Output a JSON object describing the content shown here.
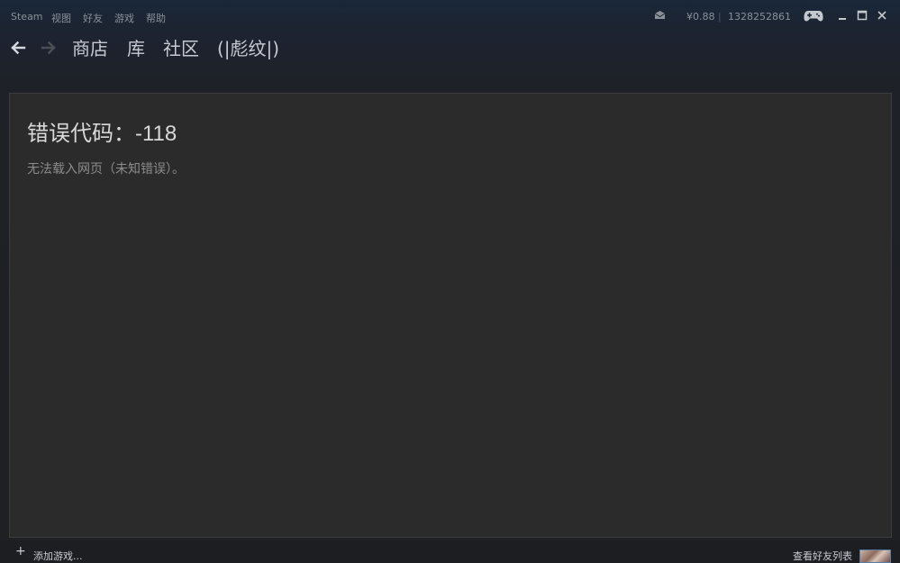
{
  "menubar": {
    "items": [
      "Steam",
      "视图",
      "好友",
      "游戏",
      "帮助"
    ],
    "wallet": "¥0.88",
    "separator": "|",
    "account_id": "1328252861"
  },
  "nav": {
    "links": [
      "商店",
      "库",
      "社区",
      "(|彪纹|)"
    ]
  },
  "error": {
    "title": "错误代码：-118",
    "message": "无法载入网页（未知错误）。"
  },
  "bottombar": {
    "add_game_plus": "+",
    "add_game_label": "添加游戏...",
    "friends_label": "查看好友列表"
  },
  "icons": {
    "mail": "envelope-icon",
    "controller": "gamepad-icon",
    "minimize": "minimize-icon",
    "maximize": "maximize-icon",
    "close": "close-icon",
    "back": "arrow-left-icon",
    "forward": "arrow-right-icon"
  },
  "colors": {
    "nav_text": "#c7cbd1",
    "menu_text": "#8a9099",
    "panel_bg": "#2b2b2b",
    "title_text": "#d8d8d8",
    "message_text": "#8c8c8c"
  }
}
